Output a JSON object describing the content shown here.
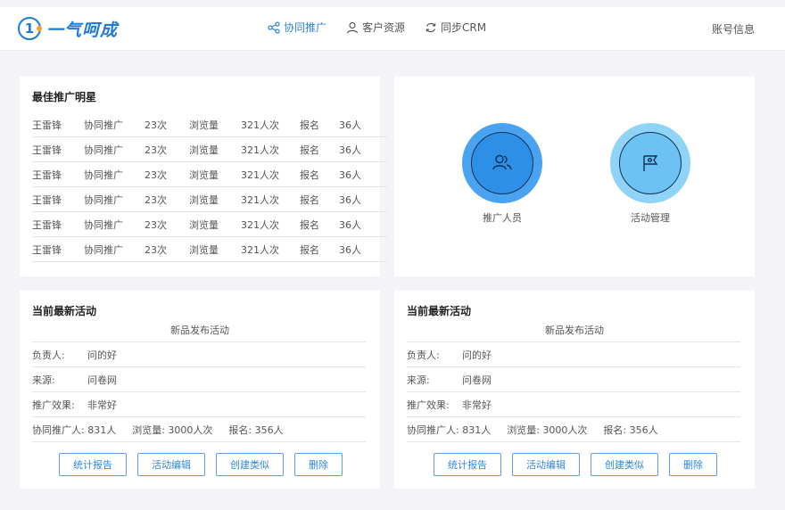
{
  "app": {
    "logo_mark": "1",
    "logo_text": "一气呵成"
  },
  "nav": [
    {
      "label": "协同推广",
      "icon": "share-icon",
      "active": true
    },
    {
      "label": "客户资源",
      "icon": "user-icon",
      "active": false
    },
    {
      "label": "同步CRM",
      "icon": "sync-icon",
      "active": false
    }
  ],
  "account": {
    "label": "账号信息"
  },
  "star": {
    "title": "最佳推广明星",
    "rows": [
      [
        "王雷锋",
        "协同推广",
        "23次",
        "浏览量",
        "321人次",
        "报名",
        "36人"
      ],
      [
        "王雷锋",
        "协同推广",
        "23次",
        "浏览量",
        "321人次",
        "报名",
        "36人"
      ],
      [
        "王雷锋",
        "协同推广",
        "23次",
        "浏览量",
        "321人次",
        "报名",
        "36人"
      ],
      [
        "王雷锋",
        "协同推广",
        "23次",
        "浏览量",
        "321人次",
        "报名",
        "36人"
      ],
      [
        "王雷锋",
        "协同推广",
        "23次",
        "浏览量",
        "321人次",
        "报名",
        "36人"
      ],
      [
        "王雷锋",
        "协同推广",
        "23次",
        "浏览量",
        "321人次",
        "报名",
        "36人"
      ]
    ]
  },
  "quick": {
    "promoters": {
      "label": "推广人员",
      "icon": "users-icon",
      "outer": "#4aa3f0",
      "inner": "#2e8fe6"
    },
    "activities": {
      "label": "活动管理",
      "icon": "flag-icon",
      "outer": "#8fd3f7",
      "inner": "#6cc2f2"
    }
  },
  "activities": [
    {
      "title": "当前最新活动",
      "subtitle": "新品发布活动",
      "owner_label": "负责人:",
      "owner": "问的好",
      "source_label": "来源:",
      "source": "问卷网",
      "effect_label": "推广效果:",
      "effect": "非常好",
      "co_promoters": "协同推广人: 831人",
      "views": "浏览量: 3000人次",
      "signups": "报名: 356人",
      "buttons": [
        "统计报告",
        "活动编辑",
        "创建类似",
        "删除"
      ]
    },
    {
      "title": "当前最新活动",
      "subtitle": "新品发布活动",
      "owner_label": "负责人:",
      "owner": "问的好",
      "source_label": "来源:",
      "source": "问卷网",
      "effect_label": "推广效果:",
      "effect": "非常好",
      "co_promoters": "协同推广人: 831人",
      "views": "浏览量: 3000人次",
      "signups": "报名: 356人",
      "buttons": [
        "统计报告",
        "活动编辑",
        "创建类似",
        "删除"
      ]
    }
  ],
  "colors": {
    "accent": "#2f86d9",
    "background": "#f4f3f7"
  }
}
